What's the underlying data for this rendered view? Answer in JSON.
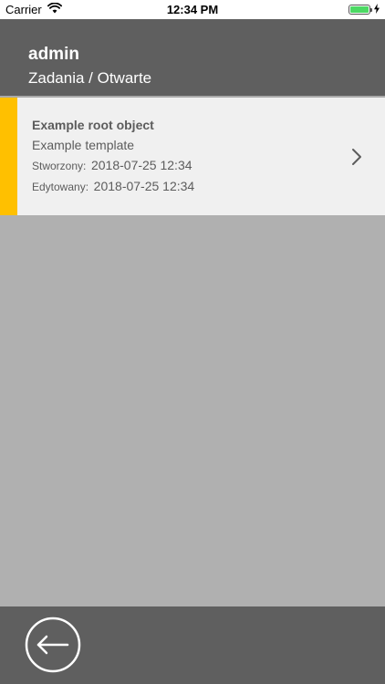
{
  "status_bar": {
    "carrier": "Carrier",
    "time": "12:34 PM",
    "wifi_icon": "wifi-icon",
    "battery_icon": "battery-full-icon",
    "charging_icon": "charging-bolt-icon",
    "battery_color": "#4cd964"
  },
  "header": {
    "user": "admin",
    "path": "Zadania / Otwarte",
    "background_color": "#5f5f5f"
  },
  "tasks": [
    {
      "title": "Example root object",
      "template": "Example template",
      "created_label": "Stworzony:",
      "created_value": "2018-07-25 12:34",
      "edited_label": "Edytowany:",
      "edited_value": "2018-07-25 12:34",
      "stripe_color": "#ffc000",
      "chevron_icon": "chevron-right-icon"
    }
  ],
  "bottom_bar": {
    "back_icon": "arrow-left-circle-icon"
  }
}
